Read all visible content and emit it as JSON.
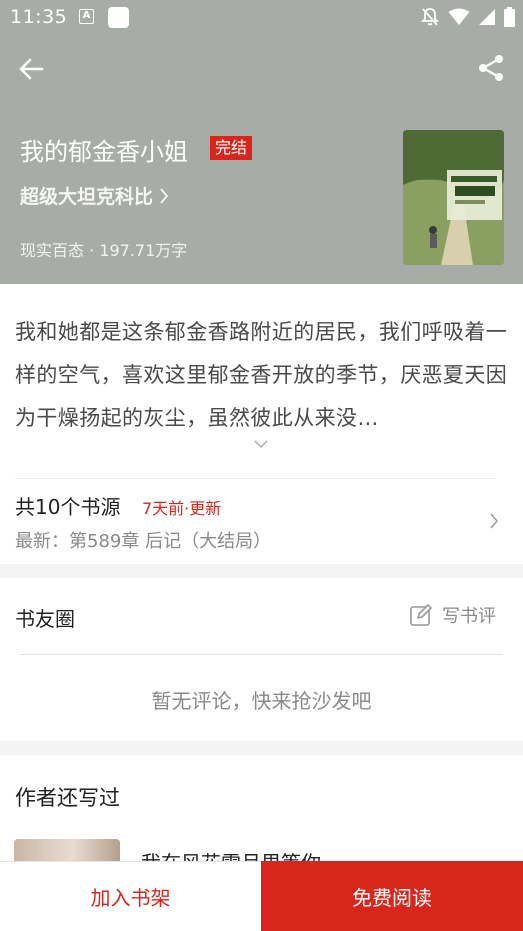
{
  "status_bar": {
    "time": "11:35",
    "app_badge": "A"
  },
  "header": {
    "background_color": "#a8aca6",
    "book_title": "我的郁金香小姐",
    "status_badge": "完结",
    "author": "超级大坦克科比",
    "category_and_words": "现实百态 · 197.71万字"
  },
  "description": {
    "text": "我和她都是这条郁金香路附近的居民，我们呼吸着一样的空气，喜欢这里郁金香开放的季节，厌恶夏天因为干燥扬起的灰尘，虽然彼此从来没…"
  },
  "sources": {
    "count_label": "共10个书源",
    "update_label": "7天前·更新",
    "latest_label": "最新：第589章 后记（大结局）"
  },
  "comments": {
    "title": "书友圈",
    "write_review_label": "写书评",
    "empty_text": "暂无评论，快来抢沙发吧"
  },
  "author_works": {
    "title": "作者还写过",
    "items": [
      {
        "title": "我在风花雪月里等你"
      }
    ]
  },
  "bottom_bar": {
    "add_shelf_label": "加入书架",
    "read_label": "免费阅读"
  },
  "colors": {
    "accent": "#d9261c",
    "header_bg": "#a8aca6"
  },
  "icons": [
    "back-arrow-icon",
    "share-icon",
    "chevron-right-icon",
    "chevron-down-icon",
    "edit-icon",
    "wifi-icon",
    "signal-icon",
    "battery-icon",
    "notifications-off-icon"
  ]
}
